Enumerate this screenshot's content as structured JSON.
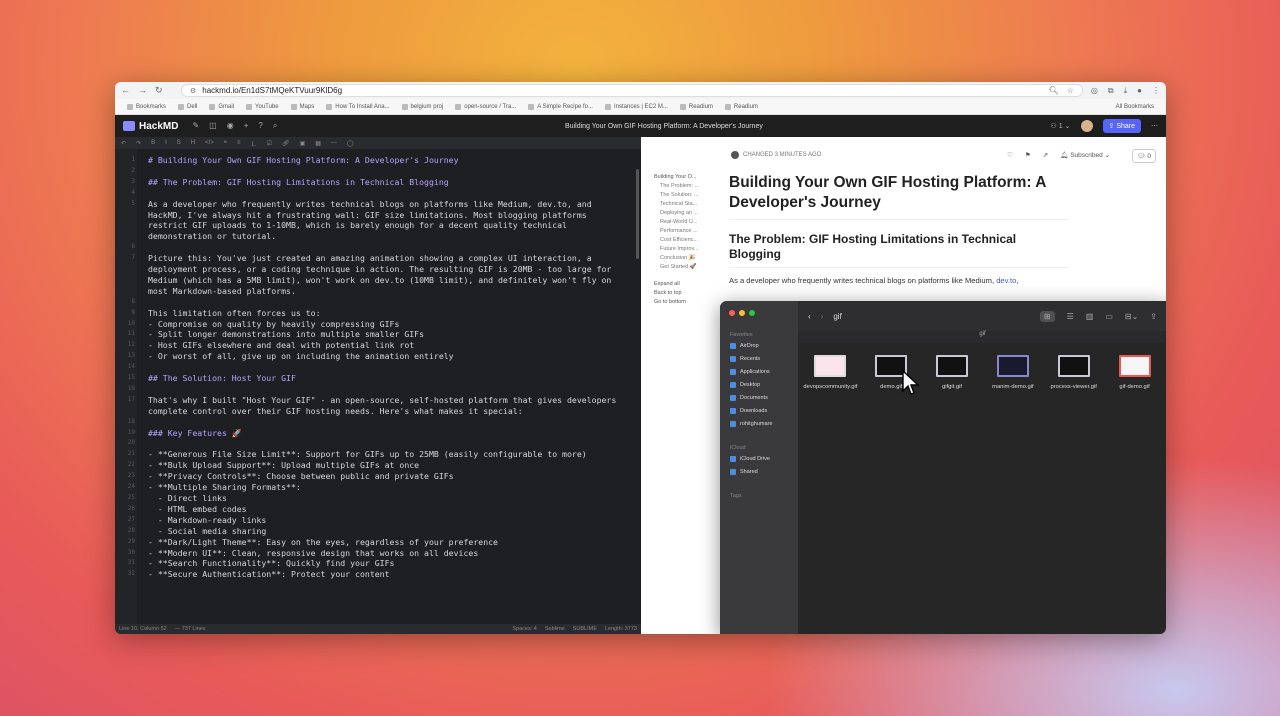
{
  "browser": {
    "url": "hackmd.io/En1dS7tMQeKTVuur9KlD6g",
    "bookmarks": [
      "Bookmarks",
      "Dell",
      "Gmail",
      "YouTube",
      "Maps",
      "How To Install Ana...",
      "belgium proj",
      "open-source / Tra...",
      "A Simple Recipe fo...",
      "Instances | EC2 M...",
      "Readium",
      "Readium"
    ],
    "all_bookmarks": "All Bookmarks"
  },
  "hackmd": {
    "logo": "HackMD",
    "doc_title": "Building Your Own GIF Hosting Platform: A Developer's Journey",
    "viewers": "1",
    "share": "Share",
    "changed": "CHANGED 3 MINUTES AGO",
    "subscribed": "Subscribed",
    "comment_count": "0"
  },
  "editor": {
    "lines": [
      {
        "n": "1",
        "t": "# Building Your Own GIF Hosting Platform: A Developer's Journey",
        "h": true
      },
      {
        "n": "2",
        "t": "",
        "h": false
      },
      {
        "n": "3",
        "t": "## The Problem: GIF Hosting Limitations in Technical Blogging",
        "h": true
      },
      {
        "n": "4",
        "t": "",
        "h": false
      },
      {
        "n": "5",
        "t": "As a developer who frequently writes technical blogs on platforms like Medium, dev.to, and HackMD, I've always hit a frustrating wall: GIF size limitations. Most blogging platforms restrict GIF uploads to 1-10MB, which is barely enough for a decent quality technical demonstration or tutorial.",
        "h": false
      },
      {
        "n": "6",
        "t": "",
        "h": false
      },
      {
        "n": "7",
        "t": "Picture this: You've just created an amazing animation showing a complex UI interaction, a deployment process, or a coding technique in action. The resulting GIF is 20MB - too large for Medium (which has a 5MB limit), won't work on dev.to (10MB limit), and definitely won't fly on most Markdown-based platforms.",
        "h": false
      },
      {
        "n": "8",
        "t": "",
        "h": false
      },
      {
        "n": "9",
        "t": "This limitation often forces us to:",
        "h": false
      },
      {
        "n": "10",
        "t": "- Compromise on quality by heavily compressing GIFs",
        "h": false
      },
      {
        "n": "11",
        "t": "- Split longer demonstrations into multiple smaller GIFs",
        "h": false
      },
      {
        "n": "12",
        "t": "- Host GIFs elsewhere and deal with potential link rot",
        "h": false
      },
      {
        "n": "13",
        "t": "- Or worst of all, give up on including the animation entirely",
        "h": false
      },
      {
        "n": "14",
        "t": "",
        "h": false
      },
      {
        "n": "15",
        "t": "## The Solution: Host Your GIF",
        "h": true
      },
      {
        "n": "16",
        "t": "",
        "h": false
      },
      {
        "n": "17",
        "t": "That's why I built \"Host Your GIF\" - an open-source, self-hosted platform that gives developers complete control over their GIF hosting needs. Here's what makes it special:",
        "h": false
      },
      {
        "n": "18",
        "t": "",
        "h": false
      },
      {
        "n": "19",
        "t": "### Key Features 🚀",
        "h": true
      },
      {
        "n": "20",
        "t": "",
        "h": false
      },
      {
        "n": "21",
        "t": "- **Generous File Size Limit**: Support for GIFs up to 25MB (easily configurable to more)",
        "h": false
      },
      {
        "n": "22",
        "t": "- **Bulk Upload Support**: Upload multiple GIFs at once",
        "h": false
      },
      {
        "n": "23",
        "t": "- **Privacy Controls**: Choose between public and private GIFs",
        "h": false
      },
      {
        "n": "24",
        "t": "- **Multiple Sharing Formats**:",
        "h": false
      },
      {
        "n": "25",
        "t": "  - Direct links",
        "h": false
      },
      {
        "n": "26",
        "t": "  - HTML embed codes",
        "h": false
      },
      {
        "n": "27",
        "t": "  - Markdown-ready links",
        "h": false
      },
      {
        "n": "28",
        "t": "  - Social media sharing",
        "h": false
      },
      {
        "n": "29",
        "t": "- **Dark/Light Theme**: Easy on the eyes, regardless of your preference",
        "h": false
      },
      {
        "n": "30",
        "t": "- **Modern UI**: Clean, responsive design that works on all devices",
        "h": false
      },
      {
        "n": "31",
        "t": "- **Search Functionality**: Quickly find your GIFs",
        "h": false
      },
      {
        "n": "32",
        "t": "- **Secure Authentication**: Protect your content",
        "h": false
      }
    ],
    "status_left": "Line 10, Column 52",
    "status_chars": "— 737 Lines",
    "status_right": [
      "Spaces: 4",
      "Sublime",
      "SUBLIME",
      "Length: 3773"
    ]
  },
  "preview": {
    "toc": {
      "title": "Building Your O...",
      "items": [
        "The Problem: ...",
        "The Solution: ...",
        "Technical Sta...",
        "Deploying an ...",
        "Real-World U...",
        "Performance ...",
        "Cost Efficienc...",
        "Future Improv...",
        "Conclusion 🎉",
        "Get Started 🚀"
      ],
      "actions": [
        "Expand all",
        "Back to top",
        "Go to bottom"
      ]
    },
    "h1": "Building Your Own GIF Hosting Platform: A Developer's Journey",
    "h2": "The Problem: GIF Hosting Limitations in Technical Blogging",
    "para_start": "As a developer who frequently writes technical blogs on platforms like Medium, ",
    "para_link": "dev.to",
    "para_end": ","
  },
  "finder": {
    "folder": "gif",
    "path": "gif",
    "favorites_label": "Favorites",
    "favorites": [
      "AirDrop",
      "Recents",
      "Applications",
      "Desktop",
      "Documents",
      "Downloads",
      "rohitghumare"
    ],
    "icloud_label": "iCloud",
    "icloud": [
      "iCloud Drive",
      "Shared"
    ],
    "tags_label": "Tags",
    "files": [
      "devopscommunity.gif",
      "demo.gif",
      "gifgit.gif",
      "manim-demo.gif",
      "process-viewer.gif",
      "gif-demo.gif"
    ]
  }
}
